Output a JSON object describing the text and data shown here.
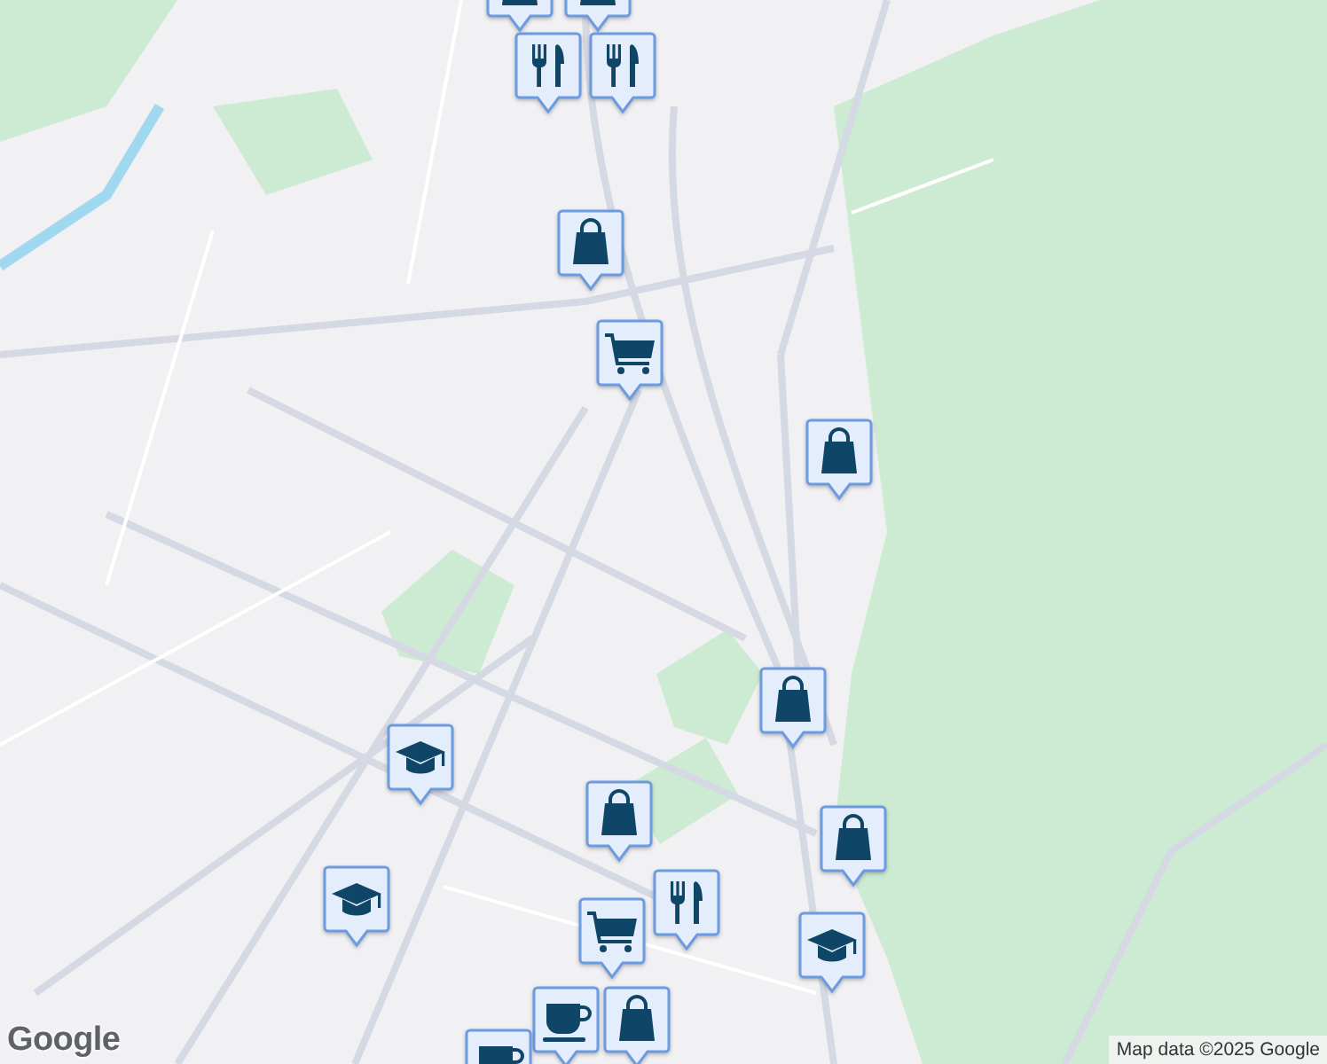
{
  "map": {
    "markers": [
      {
        "kind": "shopping"
      },
      {
        "kind": "shopping"
      },
      {
        "kind": "restaurant"
      },
      {
        "kind": "restaurant"
      },
      {
        "kind": "shopping"
      },
      {
        "kind": "grocery"
      },
      {
        "kind": "shopping"
      },
      {
        "kind": "shopping"
      },
      {
        "kind": "school"
      },
      {
        "kind": "shopping"
      },
      {
        "kind": "shopping"
      },
      {
        "kind": "school"
      },
      {
        "kind": "restaurant"
      },
      {
        "kind": "grocery"
      },
      {
        "kind": "school"
      },
      {
        "kind": "cafe"
      },
      {
        "kind": "shopping"
      },
      {
        "kind": "cafe"
      }
    ]
  },
  "attribution": {
    "logo": "Google",
    "text": "Map data ©2025 Google"
  }
}
